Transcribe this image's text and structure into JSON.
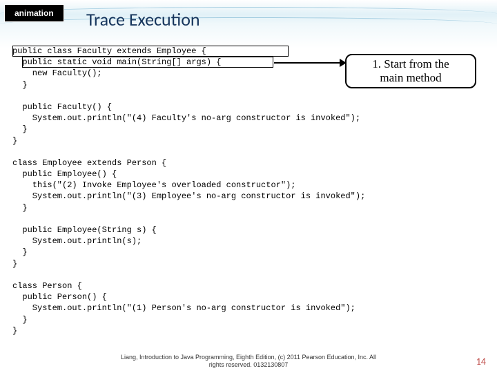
{
  "tag": "animation",
  "title": "Trace Execution",
  "callout": "1. Start from the\nmain method",
  "code": {
    "l1": "public class Faculty extends Employee {",
    "l2": "  public static void main(String[] args) {",
    "l3": "    new Faculty();",
    "l4": "  }",
    "l5": "",
    "l6": "  public Faculty() {",
    "l7": "    System.out.println(\"(4) Faculty's no-arg constructor is invoked\");",
    "l8": "  }",
    "l9": "}",
    "l10": "",
    "l11": "class Employee extends Person {",
    "l12": "  public Employee() {",
    "l13": "    this(\"(2) Invoke Employee's overloaded constructor\");",
    "l14": "    System.out.println(\"(3) Employee's no-arg constructor is invoked\");",
    "l15": "  }",
    "l16": "",
    "l17": "  public Employee(String s) {",
    "l18": "    System.out.println(s);",
    "l19": "  }",
    "l20": "}",
    "l21": "",
    "l22": "class Person {",
    "l23": "  public Person() {",
    "l24": "    System.out.println(\"(1) Person's no-arg constructor is invoked\");",
    "l25": "  }",
    "l26": "}"
  },
  "footer": {
    "line1": "Liang, Introduction to Java Programming, Eighth Edition, (c) 2011 Pearson Education, Inc. All",
    "line2": "rights reserved. 0132130807"
  },
  "page": "14"
}
